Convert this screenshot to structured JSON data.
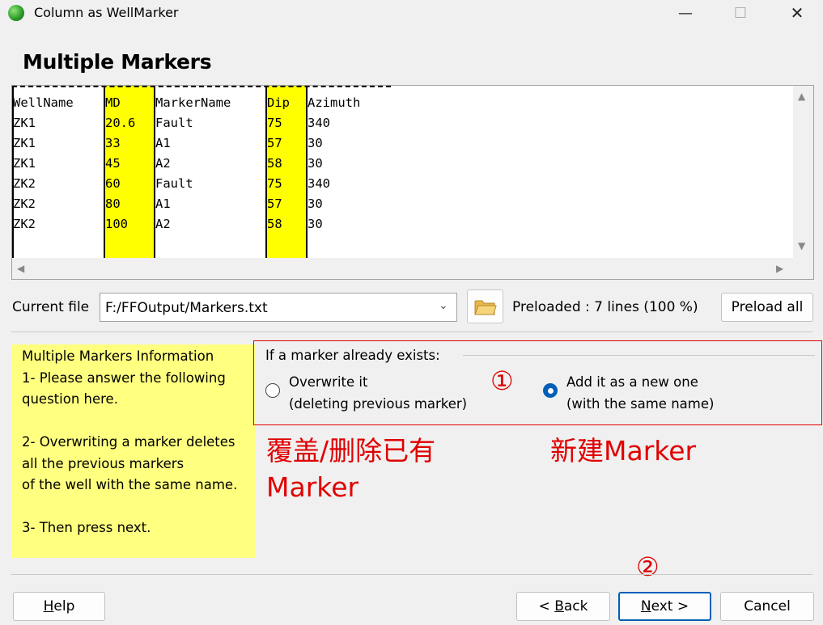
{
  "window": {
    "title": "Column as WellMarker",
    "minimize": "—",
    "maximize": "☐",
    "close": "✕"
  },
  "page_title": "Multiple Markers",
  "preview": {
    "headers": [
      "WellName",
      "MD",
      "MarkerName",
      "Dip",
      "Azimuth"
    ],
    "rows": [
      [
        "ZK1",
        "20.6",
        "Fault",
        "75",
        "340"
      ],
      [
        "ZK1",
        "33",
        "A1",
        "57",
        "30"
      ],
      [
        "ZK1",
        "45",
        "A2",
        "58",
        "30"
      ],
      [
        "ZK2",
        "60",
        "Fault",
        "75",
        "340"
      ],
      [
        "ZK2",
        "80",
        "A1",
        "57",
        "30"
      ],
      [
        "ZK2",
        "100",
        "A2",
        "58",
        "30"
      ]
    ],
    "highlight_color": "#ffff00"
  },
  "file": {
    "label": "Current file",
    "value": "F:/FFOutput/Markers.txt",
    "preload_status": "Preloaded : 7 lines (100 %)",
    "preload_all": "Preload all"
  },
  "info": {
    "text": "Multiple Markers Information\n1- Please answer the following\nquestion here.\n\n2- Overwriting a marker deletes\nall the previous markers\nof the well with the same name.\n\n3- Then press next.",
    "bg_color": "#ffff80"
  },
  "group": {
    "legend": "If a marker already exists:",
    "option_overwrite_line1": "Overwrite it",
    "option_overwrite_line2": "(deleting previous marker)",
    "option_add_line1": "Add it as a new one",
    "option_add_line2": "(with the same name)",
    "selected": "add"
  },
  "annotations": {
    "circle1": "①",
    "circle2": "②",
    "left_line1": "覆盖/删除已有",
    "left_line2": "Marker",
    "right": "新建Marker",
    "color": "#e00000"
  },
  "buttons": {
    "help": "Help",
    "help_mnemonic": "H",
    "back_prefix": "< ",
    "back": "Back",
    "back_mnemonic": "B",
    "next": "Next",
    "next_mnemonic": "N",
    "next_suffix": " >",
    "cancel": "Cancel"
  }
}
